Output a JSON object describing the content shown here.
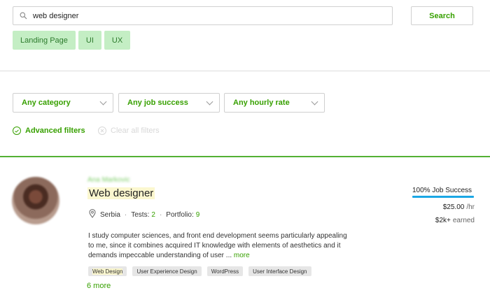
{
  "search": {
    "value": "web designer",
    "button_label": "Search",
    "chips": [
      "Landing Page",
      "UI",
      "UX"
    ]
  },
  "filters": {
    "category": "Any category",
    "job_success": "Any job success",
    "hourly_rate": "Any hourly rate",
    "advanced": "Advanced filters",
    "clear": "Clear all filters"
  },
  "result": {
    "name": "Ana Markovic",
    "title": "Web designer",
    "location": "Serbia",
    "tests_label": "Tests:",
    "tests_value": "2",
    "portfolio_label": "Portfolio:",
    "portfolio_value": "9",
    "separator": "·",
    "description": "I study computer sciences, and front end development seems particularly appealing to me, since it combines acquired IT knowledge with elements of aesthetics and it demands impeccable understanding of user ...",
    "more_link": "more",
    "skills": [
      "Web Design",
      "User Experience Design",
      "WordPress",
      "User Interface Design"
    ],
    "more_skills": "6 more",
    "job_success": "100% Job Success",
    "job_success_pct": 100,
    "rate": "$25.00",
    "rate_unit": "/hr",
    "earned": "$2k+",
    "earned_unit": "earned"
  },
  "colors": {
    "accent": "#37a000",
    "chip_bg": "#c4eec4",
    "job_success_bar": "#1ba7e5",
    "divider_green": "#53b034"
  }
}
